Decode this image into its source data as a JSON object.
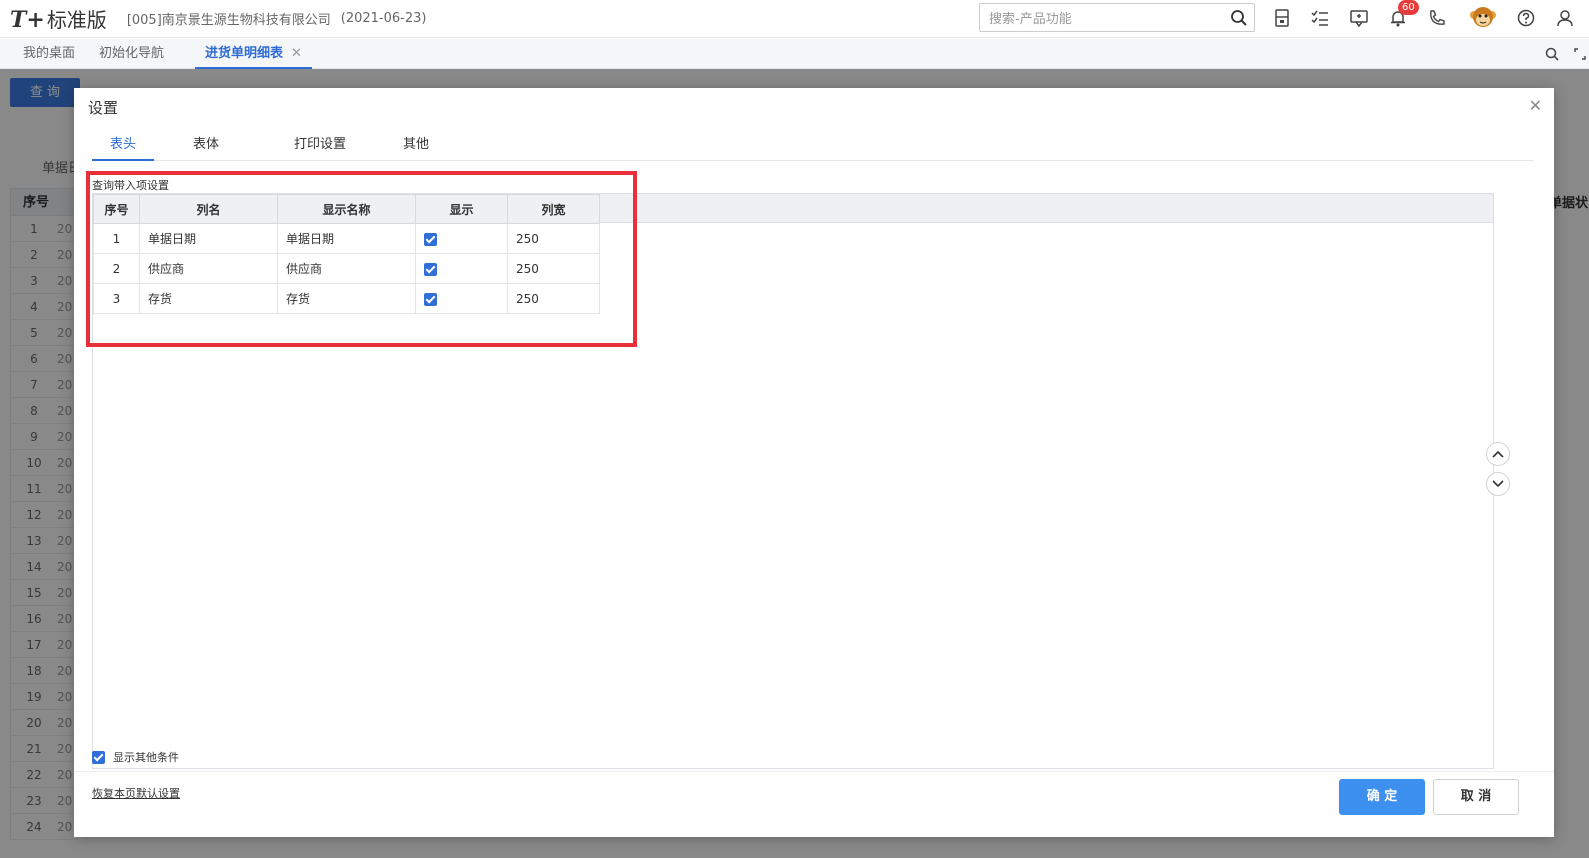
{
  "app": {
    "logo_t": "T+",
    "logo_name": "标准版",
    "company": "[005]南京景生源生物科技有限公司",
    "date": "(2021-06-23)",
    "search_placeholder": "搜索-产品功能",
    "notification_count": "60"
  },
  "tabs": [
    {
      "label": "我的桌面"
    },
    {
      "label": "初始化导航"
    },
    {
      "label": "进货单明细表"
    }
  ],
  "page": {
    "query_button": "查 询",
    "partial_label": "单据日",
    "seq_header": "序号",
    "right_header": "单据状",
    "row_numbers": [
      "1",
      "2",
      "3",
      "4",
      "5",
      "6",
      "7",
      "8",
      "9",
      "10",
      "11",
      "12",
      "13",
      "14",
      "15",
      "16",
      "17",
      "18",
      "19",
      "20",
      "21",
      "22",
      "23",
      "24"
    ],
    "row_prefix": "20"
  },
  "dialog": {
    "title": "设置",
    "tabs": [
      {
        "label": "表头"
      },
      {
        "label": "表体"
      },
      {
        "label": "打印设置"
      },
      {
        "label": "其他"
      }
    ],
    "section_label": "查询带入项设置",
    "columns": [
      "序号",
      "列名",
      "显示名称",
      "显示",
      "列宽"
    ],
    "rows": [
      {
        "seq": "1",
        "name": "单据日期",
        "display": "单据日期",
        "shown": true,
        "width": "250"
      },
      {
        "seq": "2",
        "name": "供应商",
        "display": "供应商",
        "shown": true,
        "width": "250"
      },
      {
        "seq": "3",
        "name": "存货",
        "display": "存货",
        "shown": true,
        "width": "250"
      }
    ],
    "show_other": "显示其他条件",
    "restore_link": "恢复本页默认设置",
    "ok": "确 定",
    "cancel": "取 消"
  },
  "colors": {
    "accent": "#2d6cd6",
    "primary_button": "#3d8ff0",
    "highlight_box": "#e8303a",
    "badge": "#e83b3b"
  }
}
